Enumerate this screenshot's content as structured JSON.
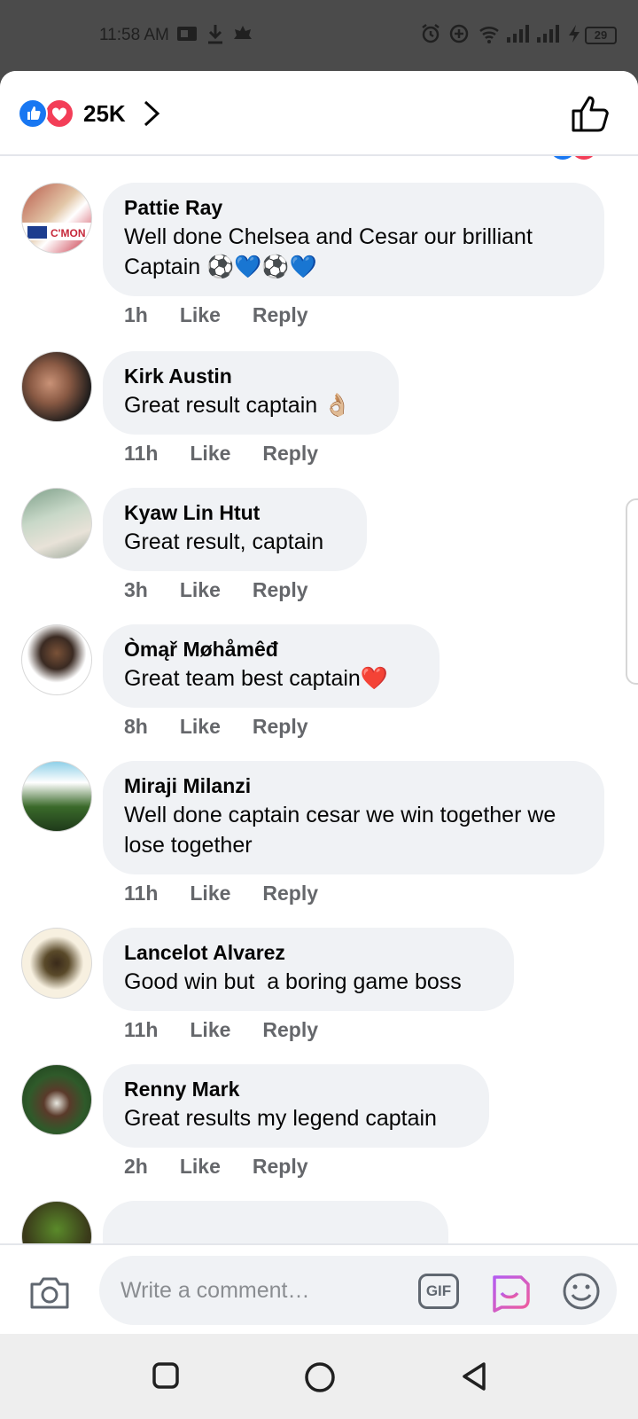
{
  "status_bar": {
    "time": "11:58 AM",
    "battery": "29",
    "icons": [
      "sim-card-icon",
      "download-icon",
      "app-notification-icon",
      "alarm-icon",
      "data-saver-icon",
      "wifi-icon",
      "signal-icon",
      "signal-icon-2",
      "charging-icon"
    ]
  },
  "header": {
    "reaction_count": "25K",
    "reactions": [
      "like",
      "love"
    ]
  },
  "comments": [
    {
      "author": "Pattie Ray",
      "text": "Well done Chelsea and Cesar our brilliant\nCaptain ⚽💙⚽💙",
      "time": "1h",
      "like": "Like",
      "reply": "Reply"
    },
    {
      "author": "Kirk Austin",
      "text": "Great result captain 👌🏼",
      "time": "11h",
      "like": "Like",
      "reply": "Reply"
    },
    {
      "author": "Kyaw Lin Htut",
      "text": "Great result, captain",
      "time": "3h",
      "like": "Like",
      "reply": "Reply"
    },
    {
      "author": "Òmąř Møhåmêđ",
      "text": "Great team best captain❤️",
      "time": "8h",
      "like": "Like",
      "reply": "Reply"
    },
    {
      "author": "Miraji Milanzi",
      "text": "Well done captain cesar we win together we\nlose together",
      "time": "11h",
      "like": "Like",
      "reply": "Reply"
    },
    {
      "author": "Lancelot Alvarez",
      "text": "Good win but  a boring game boss",
      "time": "11h",
      "like": "Like",
      "reply": "Reply"
    },
    {
      "author": "Renny Mark",
      "text": "Great results my legend captain",
      "time": "2h",
      "like": "Like",
      "reply": "Reply"
    }
  ],
  "composer": {
    "placeholder": "Write a comment…",
    "gif_label": "GIF"
  },
  "colors": {
    "brand_blue": "#1877f2",
    "love_red": "#f33e58",
    "bubble_gray": "#f0f2f5",
    "meta_gray": "#65676b"
  }
}
